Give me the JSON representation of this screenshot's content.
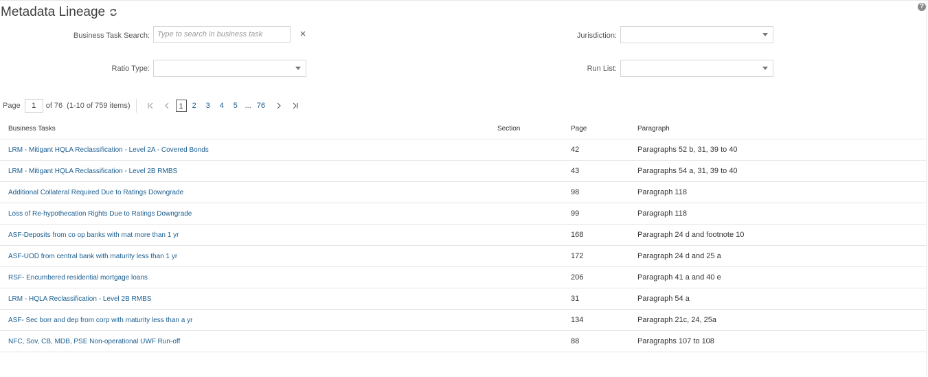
{
  "page": {
    "title": "Metadata Lineage",
    "help": "?"
  },
  "filters": {
    "business_task_label": "Business Task Search:",
    "business_task_placeholder": "Type to search in business task",
    "business_task_value": "",
    "jurisdiction_label": "Jurisdiction:",
    "jurisdiction_value": "",
    "ratio_type_label": "Ratio Type:",
    "ratio_type_value": "",
    "run_list_label": "Run List:",
    "run_list_value": ""
  },
  "pager": {
    "page_label": "Page",
    "current_page": "1",
    "of_label": "of 76",
    "items_summary": "(1-10 of 759 items)",
    "pages": [
      "1",
      "2",
      "3",
      "4",
      "5"
    ],
    "ellipsis": "...",
    "last_page": "76"
  },
  "table": {
    "columns": [
      "Business Tasks",
      "Section",
      "Page",
      "Paragraph"
    ],
    "rows": [
      [
        "LRM - Mitigant HQLA Reclassification - Level 2A - Covered Bonds",
        "",
        "42",
        "Paragraphs 52 b, 31, 39 to 40"
      ],
      [
        "LRM - Mitigant HQLA Reclassification - Level 2B RMBS",
        "",
        "43",
        "Paragraphs 54 a, 31, 39 to 40"
      ],
      [
        "Additional Collateral Required Due to Ratings Downgrade",
        "",
        "98",
        "Paragraph 118"
      ],
      [
        "Loss of Re-hypothecation Rights Due to Ratings Downgrade",
        "",
        "99",
        "Paragraph 118"
      ],
      [
        "ASF-Deposits from co op banks with mat more than 1 yr",
        "",
        "168",
        "Paragraph 24 d and footnote 10"
      ],
      [
        "ASF-UOD from central bank with maturity less than 1 yr",
        "",
        "172",
        "Paragraph 24 d and 25 a"
      ],
      [
        "RSF- Encumbered residential mortgage loans",
        "",
        "206",
        "Paragraph 41 a and 40 e"
      ],
      [
        "LRM - HQLA Reclassification - Level 2B RMBS",
        "",
        "31",
        "Paragraph 54 a"
      ],
      [
        "ASF- Sec borr and dep from corp with maturity less than a yr",
        "",
        "134",
        "Paragraph 21c, 24, 25a"
      ],
      [
        "NFC, Sov, CB, MDB, PSE Non-operational UWF Run-off",
        "",
        "88",
        "Paragraphs 107 to 108"
      ]
    ]
  }
}
